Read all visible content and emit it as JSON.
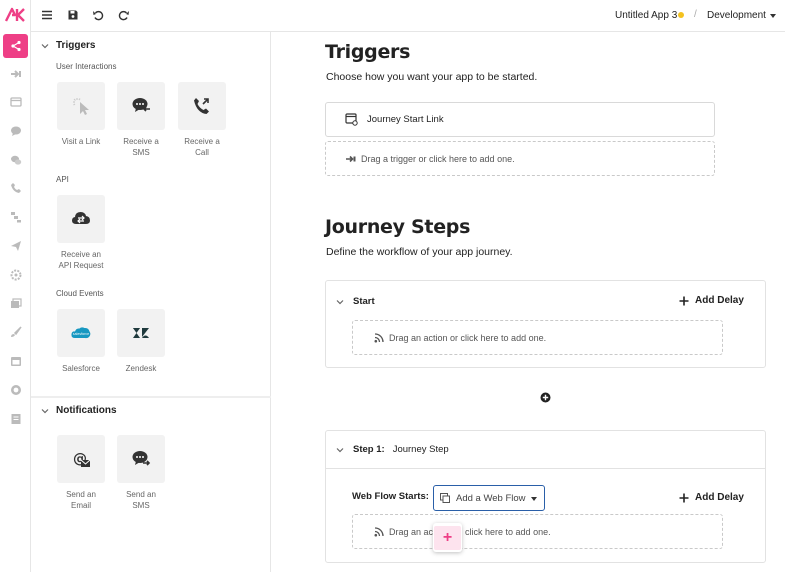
{
  "topbar": {
    "app_name": "Untitled App 3",
    "separator": "/",
    "environment": "Development",
    "status_color": "#f4c21f",
    "icons": [
      "menu-icon",
      "save-icon",
      "undo-icon",
      "redo-icon"
    ]
  },
  "brand": {
    "logo_text": "AK",
    "accent": "#ee3f86"
  },
  "rail": {
    "items": [
      "flow-icon",
      "trigger-icon",
      "web-icon",
      "chat-icon",
      "chat-bubbles-icon",
      "phone-icon",
      "steps-icon",
      "send-icon",
      "settings-icon",
      "cards-icon",
      "brush-icon",
      "calendar-icon",
      "help-icon",
      "document-icon"
    ]
  },
  "panel": {
    "triggers": {
      "title": "Triggers",
      "groups": [
        {
          "label": "User Interactions",
          "tiles": [
            {
              "label_1": "Visit a Link",
              "label_2": "",
              "icon": "click-icon"
            },
            {
              "label_1": "Receive a",
              "label_2": "SMS",
              "icon": "sms-receive-icon"
            },
            {
              "label_1": "Receive a",
              "label_2": "Call",
              "icon": "phone-call-icon"
            }
          ]
        },
        {
          "label": "API",
          "tiles": [
            {
              "label_1": "Receive an",
              "label_2": "API Request",
              "icon": "api-icon"
            }
          ]
        },
        {
          "label": "Cloud Events",
          "tiles": [
            {
              "label_1": "Salesforce",
              "label_2": "",
              "icon": "salesforce-icon"
            },
            {
              "label_1": "Zendesk",
              "label_2": "",
              "icon": "zendesk-icon"
            }
          ]
        }
      ]
    },
    "notifications": {
      "title": "Notifications",
      "tiles": [
        {
          "label_1": "Send an",
          "label_2": "Email",
          "icon": "email-icon"
        },
        {
          "label_1": "Send an",
          "label_2": "SMS",
          "icon": "sms-send-icon"
        }
      ]
    }
  },
  "main": {
    "triggers": {
      "title": "Triggers",
      "subtitle": "Choose how you want your app to be started.",
      "trigger_item": "Journey Start Link",
      "drop_hint": "Drag a trigger or click here to add one."
    },
    "steps": {
      "title": "Journey Steps",
      "subtitle": "Define the workflow of your app journey.",
      "add_delay": "Add Delay",
      "start_card": {
        "title": "Start",
        "drop_hint": "Drag an action or click here to add one."
      },
      "step_card": {
        "prefix": "Step 1:",
        "name": "Journey Step",
        "web_flow_label": "Web Flow Starts:",
        "web_flow_placeholder": "Add a Web Flow",
        "drop_hint_left": "Drag an ac",
        "drop_hint_right": "click here to add one."
      },
      "fab_symbol": "+"
    }
  }
}
